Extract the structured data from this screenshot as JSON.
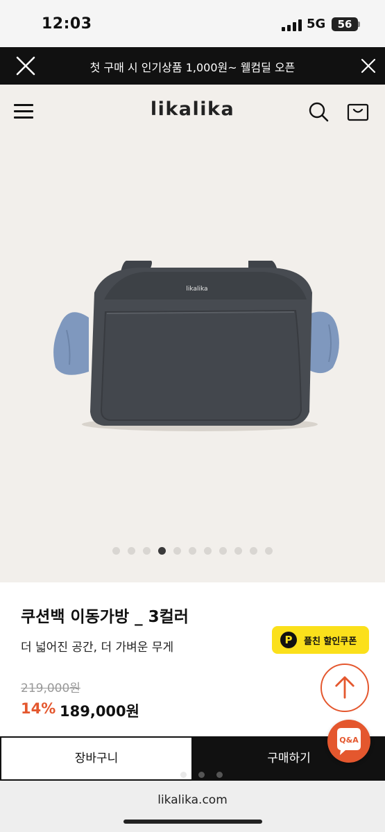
{
  "status_bar": {
    "time": "12:03",
    "network": "5G",
    "battery": "56"
  },
  "promo": {
    "text": "첫 구매 시 인기상품 1,000원~ 웰컴딜 오픈"
  },
  "header": {
    "logo": "likalika"
  },
  "product_image": {
    "bag_logo": "likalika",
    "slide_count": 11,
    "active_slide": 4
  },
  "product": {
    "title": "쿠션백 이동가방 _ 3컬러",
    "subtitle": "더 넓어진 공간, 더 가벼운 무게",
    "coupon_label": "플친 할인쿠폰",
    "coupon_icon": "P",
    "original_price": "219,000원",
    "discount": "14%",
    "price": "189,000원"
  },
  "floating": {
    "qa_label": "Q&A"
  },
  "bottom_bar": {
    "cart_label": "장바구니",
    "buy_label": "구매하기"
  },
  "browser": {
    "url": "likalika.com"
  },
  "colors": {
    "accent": "#e4572e",
    "coupon": "#fbe01b",
    "dark": "#111111",
    "background": "#f2efeb"
  }
}
